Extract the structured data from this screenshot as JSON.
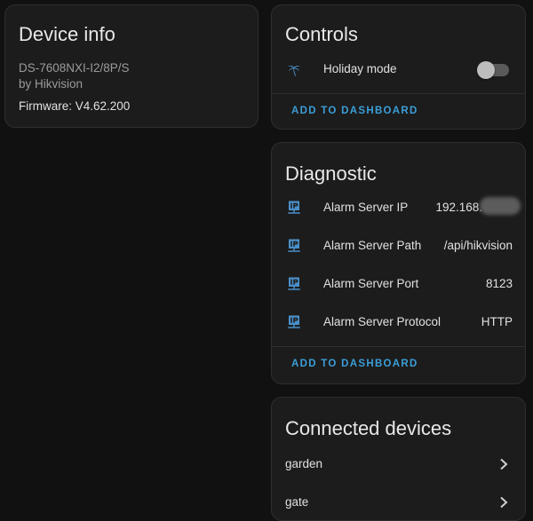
{
  "device_info": {
    "title": "Device info",
    "model": "DS-7608NXI-I2/8P/S",
    "manufacturer": "by Hikvision",
    "firmware": "Firmware: V4.62.200"
  },
  "controls": {
    "title": "Controls",
    "holiday_mode": {
      "label": "Holiday mode",
      "icon": "palm-tree-icon",
      "state": "off"
    },
    "action_label": "ADD TO DASHBOARD"
  },
  "diagnostic": {
    "title": "Diagnostic",
    "rows": [
      {
        "label": "Alarm Server IP",
        "value": "192.168.",
        "icon": "ip-network-icon"
      },
      {
        "label": "Alarm Server Path",
        "value": "/api/hikvision",
        "icon": "ip-network-icon"
      },
      {
        "label": "Alarm Server Port",
        "value": "8123",
        "icon": "ip-network-icon"
      },
      {
        "label": "Alarm Server Protocol",
        "value": "HTTP",
        "icon": "ip-network-icon"
      }
    ],
    "action_label": "ADD TO DASHBOARD"
  },
  "connected_devices": {
    "title": "Connected devices",
    "items": [
      {
        "label": "garden"
      },
      {
        "label": "gate"
      }
    ]
  },
  "colors": {
    "background": "#111111",
    "card": "#1c1c1c",
    "accent": "#3b9ed8",
    "icon": "#4a8fc9"
  }
}
